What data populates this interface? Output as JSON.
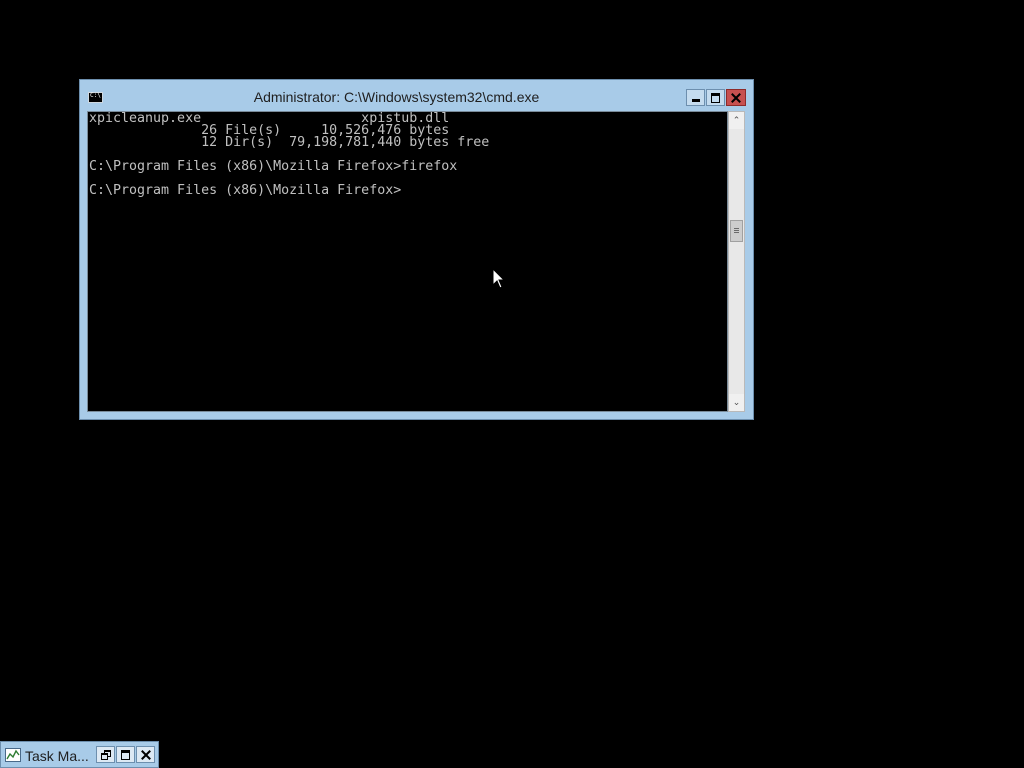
{
  "window": {
    "title": "Administrator: C:\\Windows\\system32\\cmd.exe",
    "icon": "cmd-icon"
  },
  "console": {
    "lines": [
      "xpicleanup.exe                    xpistub.dll",
      "              26 File(s)     10,526,476 bytes",
      "              12 Dir(s)  79,198,781,440 bytes free",
      "",
      "C:\\Program Files (x86)\\Mozilla Firefox>firefox",
      "",
      "C:\\Program Files (x86)\\Mozilla Firefox>"
    ]
  },
  "scrollbar": {
    "up_glyph": "⌃",
    "down_glyph": "⌄"
  },
  "taskmgr": {
    "title": "Task Ma...",
    "icon": "task-manager-icon"
  },
  "colors": {
    "desktop": "#000000",
    "titlebar": "#a8cbe8",
    "close": "#c75050",
    "console_bg": "#000000",
    "console_fg": "#c0c0c0"
  }
}
